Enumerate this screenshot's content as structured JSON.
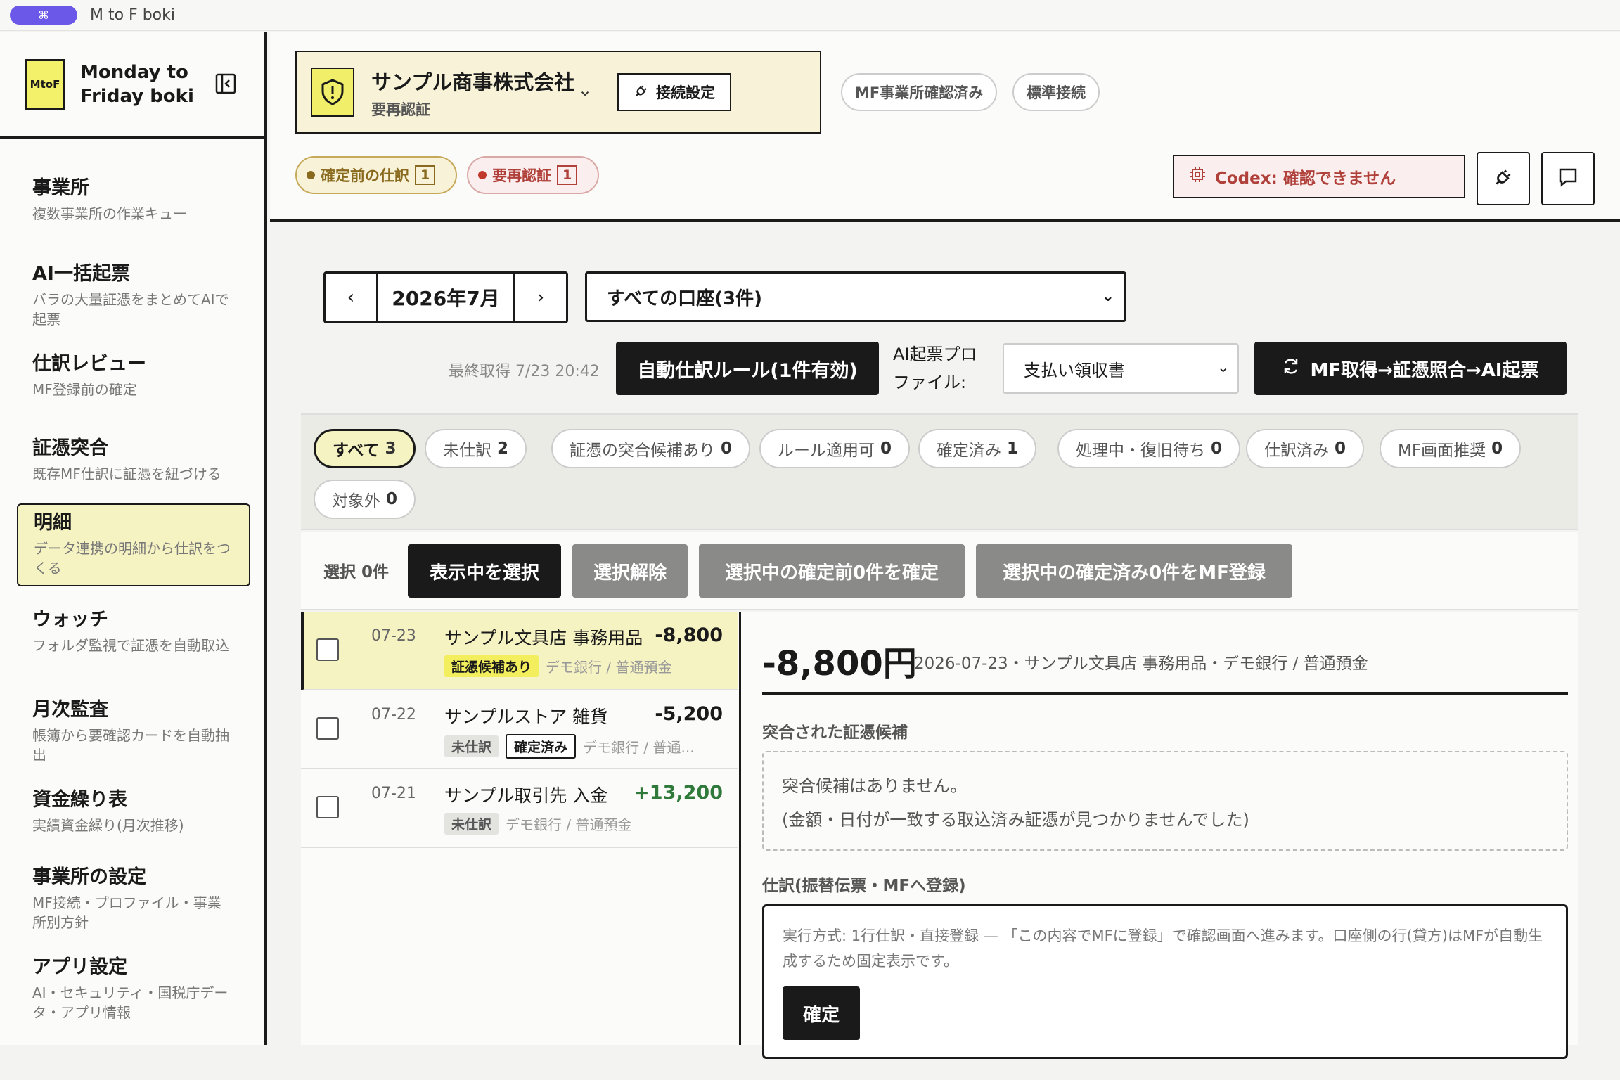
{
  "window": {
    "title": "M to F boki",
    "cmd_symbol": "⌘"
  },
  "brand": {
    "logo": "MtoF",
    "name_line1": "Monday to",
    "name_line2": "Friday boki"
  },
  "sidebar": {
    "items": [
      {
        "title": "事業所",
        "desc": "複数事業所の作業キュー"
      },
      {
        "title": "AI一括起票",
        "desc": "バラの大量証憑をまとめてAIで起票"
      },
      {
        "title": "仕訳レビュー",
        "desc": "MF登録前の確定"
      },
      {
        "title": "証憑突合",
        "desc": "既存MF仕訳に証憑を紐づける"
      },
      {
        "title": "明細",
        "desc": "データ連携の明細から仕訳をつくる"
      },
      {
        "title": "ウォッチ",
        "desc": "フォルダ監視で証憑を自動取込"
      },
      {
        "title": "月次監査",
        "desc": "帳簿から要確認カードを自動抽出"
      },
      {
        "title": "資金繰り表",
        "desc": "実績資金繰り(月次推移)"
      },
      {
        "title": "事業所の設定",
        "desc": "MF接続・プロファイル・事業所別方針"
      },
      {
        "title": "アプリ設定",
        "desc": "AI・セキュリティ・国税庁データ・アプリ情報"
      }
    ]
  },
  "header": {
    "company_name": "サンプル商事株式会社",
    "company_status": "要再認証",
    "connection_button": "接続設定",
    "pill_mf_confirmed": "MF事業所確認済み",
    "pill_standard": "標準接続",
    "status_pending": {
      "label": "確定前の仕訳",
      "count": "1"
    },
    "status_reauth": {
      "label": "要再認証",
      "count": "1"
    },
    "codex_status": "Codex: 確認できません"
  },
  "toolbar": {
    "month": "2026年7月",
    "account_select": "すべての口座(3件)",
    "last_fetch": "最終取得 7/23 20:42",
    "auto_rule_button": "自動仕訳ルール(1件有効)",
    "profile_label_line1": "AI起票プロ",
    "profile_label_line2": "ファイル:",
    "profile_select": "支払い領収書",
    "run_button": "MF取得→証憑照合→AI起票"
  },
  "filters": [
    {
      "label": "すべて",
      "count": "3"
    },
    {
      "label": "未仕訳",
      "count": "2"
    },
    {
      "label": "証憑の突合候補あり",
      "count": "0"
    },
    {
      "label": "ルール適用可",
      "count": "0"
    },
    {
      "label": "確定済み",
      "count": "1"
    },
    {
      "label": "処理中・復旧待ち",
      "count": "0"
    },
    {
      "label": "仕訳済み",
      "count": "0"
    },
    {
      "label": "MF画面推奨",
      "count": "0"
    },
    {
      "label": "対象外",
      "count": "0"
    }
  ],
  "bulk": {
    "selected_count": "選択 0件",
    "select_visible": "表示中を選択",
    "clear_selection": "選択解除",
    "confirm_pending": "選択中の確定前0件を確定",
    "register_confirmed": "選択中の確定済み0件をMF登録"
  },
  "transactions": [
    {
      "date": "07-23",
      "desc": "サンプル文具店 事務用品",
      "amount": "-8,800",
      "tag1": "証憑候補あり",
      "account": "デモ銀行 / 普通預金"
    },
    {
      "date": "07-22",
      "desc": "サンプルストア 雑貨",
      "amount": "-5,200",
      "tag1": "未仕訳",
      "tag2": "確定済み",
      "account": "デモ銀行 / 普通..."
    },
    {
      "date": "07-21",
      "desc": "サンプル取引先 入金",
      "amount": "+13,200",
      "tag1": "未仕訳",
      "account": "デモ銀行 / 普通預金"
    }
  ],
  "detail": {
    "amount": "-8,800円",
    "meta": "2026-07-23・サンプル文具店 事務用品・デモ銀行 / 普通預金",
    "matched_heading": "突合された証憑候補",
    "empty_line1": "突合候補はありません。",
    "empty_line2": "(金額・日付が一致する取込済み証憑が見つかりませんでした)",
    "entry_heading": "仕訳(振替伝票・MFへ登録)",
    "entry_desc": "実行方式: 1行仕訳・直接登録 — 「この内容でMFに登録」で確認画面へ進みます。口座側の行(貸方)はMFが自動生成するため固定表示です。",
    "confirm_button": "確定"
  },
  "colors": {
    "accent_yellow": "#f2ee5e",
    "dark": "#1a1a1a",
    "positive": "#2f7a3b",
    "error": "#b0403a",
    "pending_dot": "#8a6a1e",
    "reauth_dot": "#c0392b"
  }
}
